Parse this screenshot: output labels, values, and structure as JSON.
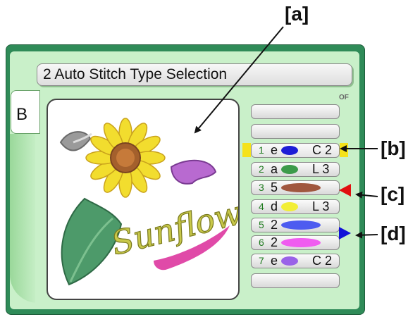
{
  "callouts": {
    "a": "[a]",
    "b": "[b]",
    "c": "[c]",
    "d": "[d]"
  },
  "window": {
    "title": "2 Auto Stitch Type Selection",
    "tab_label": "B",
    "corner_label": "OF"
  },
  "preview": {
    "artwork_text": "Sunflower"
  },
  "threads": [
    {
      "num": "1",
      "code": "e",
      "color": "#1d1dd6",
      "type": "C 2"
    },
    {
      "num": "2",
      "code": "a",
      "color": "#3c9b4a",
      "type": "L 3"
    },
    {
      "num": "3",
      "code": "5",
      "color": "#a0573e",
      "type": ""
    },
    {
      "num": "4",
      "code": "d",
      "color": "#f2ee36",
      "type": "L 3"
    },
    {
      "num": "5",
      "code": "2",
      "color": "#4d5cf0",
      "type": ""
    },
    {
      "num": "6",
      "code": "2",
      "color": "#f05cf0",
      "type": ""
    },
    {
      "num": "7",
      "code": "e",
      "color": "#9a62e8",
      "type": "C 2"
    }
  ],
  "markers": {
    "c_color": "#e11010",
    "d_color": "#1212d8"
  }
}
